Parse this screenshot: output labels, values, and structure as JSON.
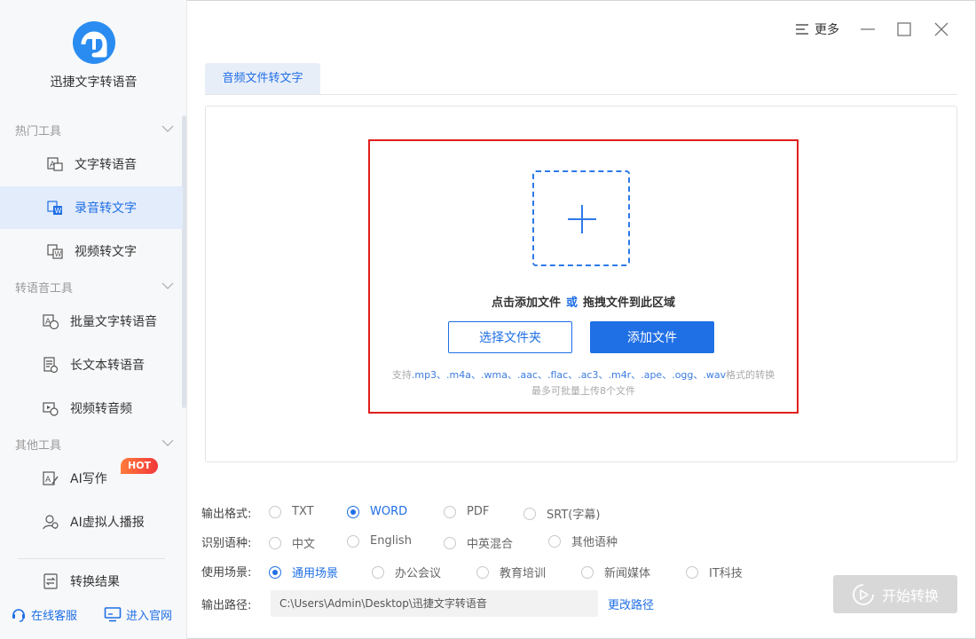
{
  "app": {
    "name": "迅捷文字转语音",
    "accent_color": "#1f6fe5",
    "alert_color": "#e01e1e"
  },
  "sidebar": {
    "groups": [
      {
        "title": "热门工具",
        "items": [
          {
            "label": "文字转语音",
            "icon": "text-to-speech-icon",
            "active": false
          },
          {
            "label": "录音转文字",
            "icon": "audio-to-text-icon",
            "active": true
          },
          {
            "label": "视频转文字",
            "icon": "video-to-text-icon",
            "active": false
          }
        ]
      },
      {
        "title": "转语音工具",
        "items": [
          {
            "label": "批量文字转语音",
            "icon": "batch-text-icon"
          },
          {
            "label": "长文本转语音",
            "icon": "long-text-icon"
          },
          {
            "label": "视频转音频",
            "icon": "video-audio-icon"
          }
        ]
      },
      {
        "title": "其他工具",
        "items": [
          {
            "label": "AI写作",
            "icon": "ai-writing-icon",
            "badge": "HOT"
          },
          {
            "label": "AI虚拟人播报",
            "icon": "ai-avatar-icon"
          }
        ]
      }
    ],
    "result_label": "转换结果",
    "footer": {
      "service_label": "在线客服",
      "website_label": "进入官网"
    }
  },
  "titlebar": {
    "more_label": "更多"
  },
  "tabs": [
    {
      "label": "音频文件转文字",
      "active": true
    }
  ],
  "upload": {
    "hint_part1": "点击添加文件",
    "hint_or": "或",
    "hint_part2": "拖拽文件到此区域",
    "choose_folder_label": "选择文件夹",
    "add_file_label": "添加文件",
    "support_prefix": "支持",
    "support_formats": ".mp3、.m4a、.wma、.aac、.flac、.ac3、.m4r、.ape、.ogg、.wav",
    "support_suffix": "格式的转换",
    "limit_text": "最多可批量上传8个文件"
  },
  "options": {
    "output_format": {
      "label": "输出格式:",
      "choices": [
        "TXT",
        "WORD",
        "PDF",
        "SRT(字幕)"
      ],
      "selected": "WORD"
    },
    "language": {
      "label": "识别语种:",
      "choices": [
        "中文",
        "English",
        "中英混合",
        "其他语种"
      ],
      "selected": null
    },
    "scene": {
      "label": "使用场景:",
      "choices": [
        "通用场景",
        "办公会议",
        "教育培训",
        "新闻媒体",
        "IT科技"
      ],
      "selected": "通用场景"
    },
    "output_path": {
      "label": "输出路径:",
      "value": "C:\\Users\\Admin\\Desktop\\迅捷文字转语音",
      "change_label": "更改路径"
    }
  },
  "start_button_label": "开始转换"
}
